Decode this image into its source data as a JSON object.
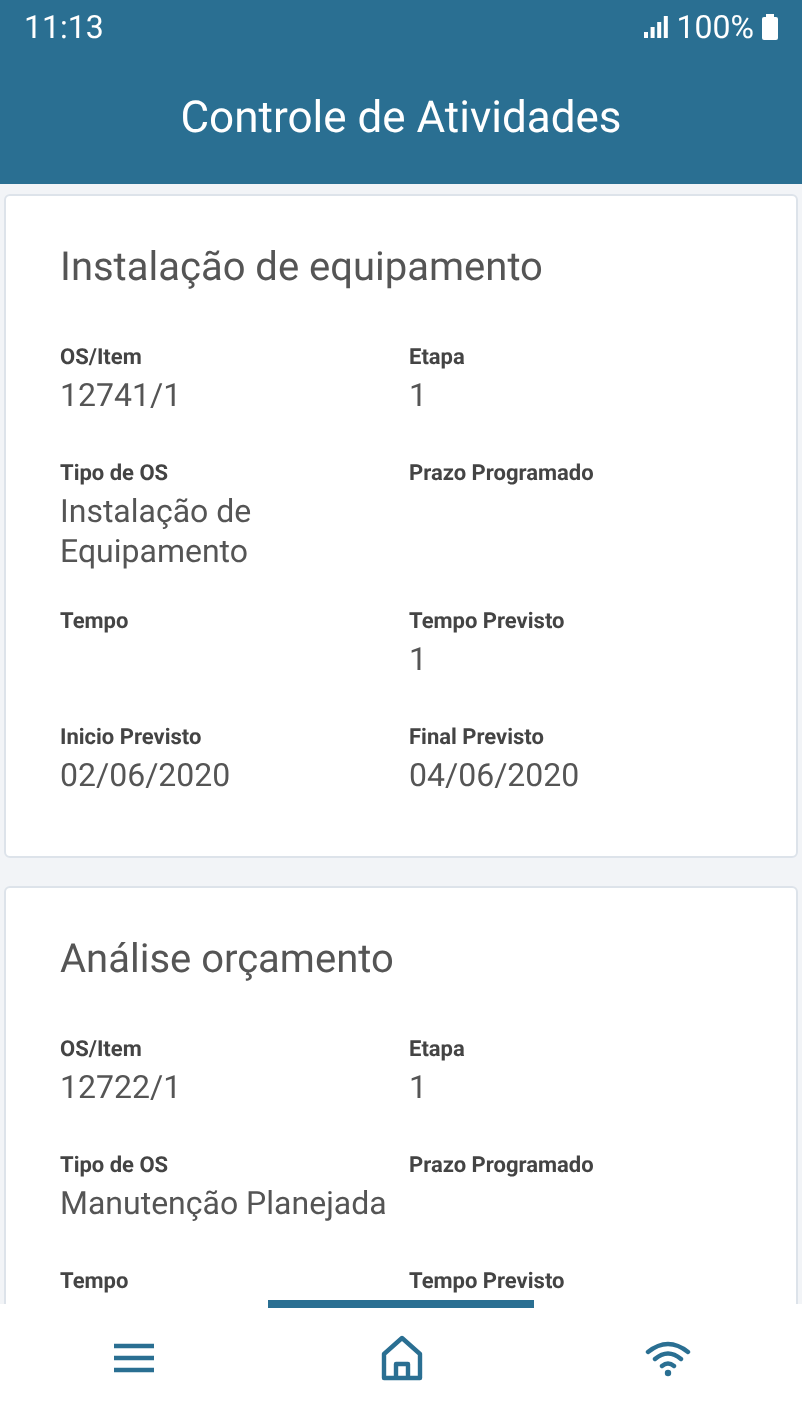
{
  "status_bar": {
    "time": "11:13",
    "battery": "100%"
  },
  "header": {
    "title": "Controle de Atividades"
  },
  "cards": [
    {
      "title": "Instalação de equipamento",
      "fields": [
        {
          "label": "OS/Item",
          "value": "12741/1"
        },
        {
          "label": "Etapa",
          "value": "1"
        },
        {
          "label": "Tipo de OS",
          "value": "Instalação de Equipamento"
        },
        {
          "label": "Prazo Programado"
        },
        {
          "label": "Tempo"
        },
        {
          "label": "Tempo Previsto",
          "value": "1"
        },
        {
          "label": "Inicio Previsto",
          "value": "02/06/2020"
        },
        {
          "label": "Final Previsto",
          "value": "04/06/2020"
        }
      ]
    },
    {
      "title": "Análise orçamento",
      "fields": [
        {
          "label": "OS/Item",
          "value": "12722/1"
        },
        {
          "label": "Etapa",
          "value": "1"
        },
        {
          "label": "Tipo de OS",
          "value": "Manutenção Planejada"
        },
        {
          "label": "Prazo Programado"
        },
        {
          "label": "Tempo"
        },
        {
          "label": "Tempo Previsto"
        }
      ]
    }
  ],
  "nav": [
    {
      "kind": "menu",
      "selected": false
    },
    {
      "kind": "home",
      "selected": true
    },
    {
      "kind": "wifi",
      "selected": false
    }
  ]
}
